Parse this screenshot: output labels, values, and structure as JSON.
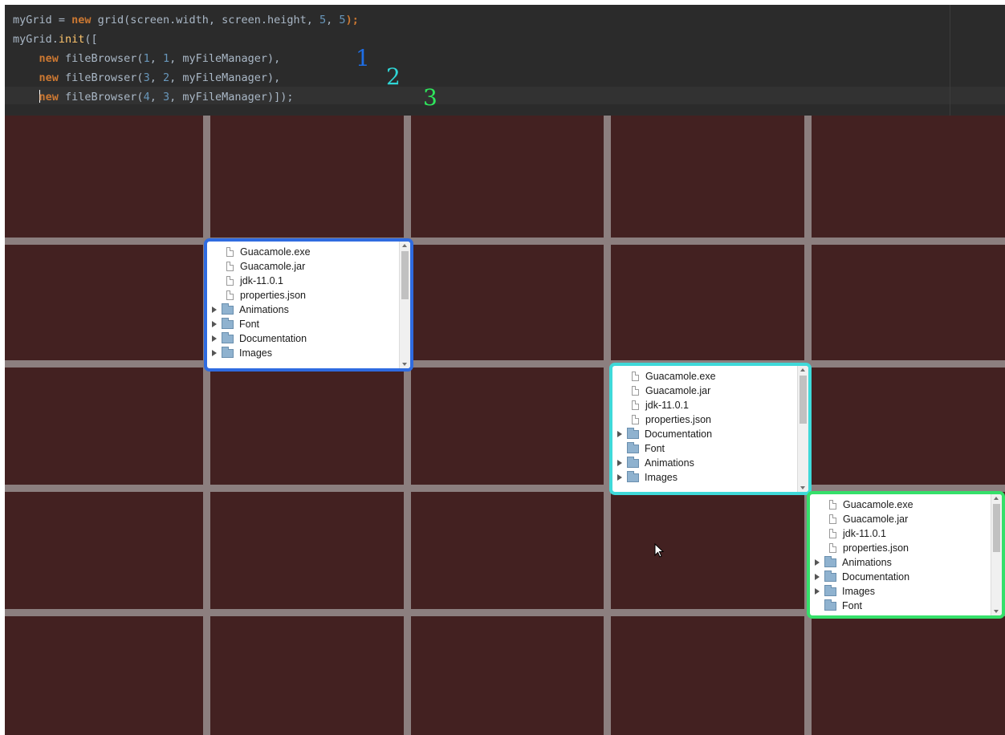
{
  "editor": {
    "lines": [
      [
        {
          "t": "myGrid = ",
          "c": "id"
        },
        {
          "t": "new ",
          "c": "kw"
        },
        {
          "t": "grid(screen.width, screen.height, ",
          "c": "id"
        },
        {
          "t": "5",
          "c": "num"
        },
        {
          "t": ", ",
          "c": "pl"
        },
        {
          "t": "5",
          "c": "num"
        },
        {
          "t": ");",
          "c": "kw"
        }
      ],
      [
        {
          "t": "myGrid.",
          "c": "id"
        },
        {
          "t": "init",
          "c": "fn"
        },
        {
          "t": "([",
          "c": "id"
        }
      ],
      [
        {
          "t": "    "
        },
        {
          "t": "new ",
          "c": "kw"
        },
        {
          "t": "fileBrowser(",
          "c": "id"
        },
        {
          "t": "1",
          "c": "num"
        },
        {
          "t": ", ",
          "c": "pl"
        },
        {
          "t": "1",
          "c": "num"
        },
        {
          "t": ", myFileManager),",
          "c": "id"
        }
      ],
      [
        {
          "t": "    "
        },
        {
          "t": "new ",
          "c": "kw"
        },
        {
          "t": "fileBrowser(",
          "c": "id"
        },
        {
          "t": "3",
          "c": "num"
        },
        {
          "t": ", ",
          "c": "pl"
        },
        {
          "t": "2",
          "c": "num"
        },
        {
          "t": ", myFileManager),",
          "c": "id"
        }
      ],
      [
        {
          "t": "    ",
          "caret": true
        },
        {
          "t": "new ",
          "c": "kw"
        },
        {
          "t": "fileBrowser(",
          "c": "id"
        },
        {
          "t": "4",
          "c": "num"
        },
        {
          "t": ", ",
          "c": "pl"
        },
        {
          "t": "3",
          "c": "num"
        },
        {
          "t": ", myFileManager)]);",
          "c": "id"
        }
      ]
    ]
  },
  "annotations": [
    {
      "label": "1",
      "color": "#1e6ee6"
    },
    {
      "label": "2",
      "color": "#2fd6d6"
    },
    {
      "label": "3",
      "color": "#2ee65c"
    }
  ],
  "browsers": [
    {
      "border_color": "#2f6be0",
      "items": [
        {
          "name": "Guacamole.exe",
          "type": "file"
        },
        {
          "name": "Guacamole.jar",
          "type": "file"
        },
        {
          "name": "jdk-11.0.1",
          "type": "file"
        },
        {
          "name": "properties.json",
          "type": "file"
        },
        {
          "name": "Animations",
          "type": "folder",
          "expandable": true
        },
        {
          "name": "Font",
          "type": "folder",
          "expandable": true
        },
        {
          "name": "Documentation",
          "type": "folder",
          "expandable": true
        },
        {
          "name": "Images",
          "type": "folder",
          "expandable": true
        }
      ]
    },
    {
      "border_color": "#3fd9d9",
      "items": [
        {
          "name": "Guacamole.exe",
          "type": "file"
        },
        {
          "name": "Guacamole.jar",
          "type": "file"
        },
        {
          "name": "jdk-11.0.1",
          "type": "file"
        },
        {
          "name": "properties.json",
          "type": "file"
        },
        {
          "name": "Documentation",
          "type": "folder",
          "expandable": true
        },
        {
          "name": "Font",
          "type": "folder",
          "expandable": false
        },
        {
          "name": "Animations",
          "type": "folder",
          "expandable": true
        },
        {
          "name": "Images",
          "type": "folder",
          "expandable": true
        }
      ]
    },
    {
      "border_color": "#35e06a",
      "items": [
        {
          "name": "Guacamole.exe",
          "type": "file"
        },
        {
          "name": "Guacamole.jar",
          "type": "file"
        },
        {
          "name": "jdk-11.0.1",
          "type": "file"
        },
        {
          "name": "properties.json",
          "type": "file"
        },
        {
          "name": "Animations",
          "type": "folder",
          "expandable": true
        },
        {
          "name": "Documentation",
          "type": "folder",
          "expandable": true
        },
        {
          "name": "Images",
          "type": "folder",
          "expandable": true
        },
        {
          "name": "Font",
          "type": "folder",
          "expandable": false
        }
      ]
    }
  ],
  "grid": {
    "columns": 5,
    "rows": 5,
    "background": "#432121",
    "line_color": "#8c7f7f"
  }
}
